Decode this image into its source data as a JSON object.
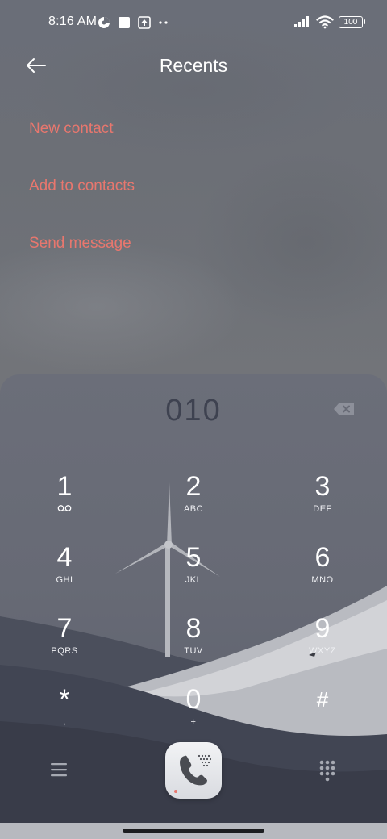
{
  "status_bar": {
    "time": "8:16 AM",
    "battery_label": "100",
    "icons_left": [
      "data-saver-icon",
      "app-square-icon",
      "upload-icon",
      "more-dots-icon"
    ],
    "icons_right": [
      "signal-icon",
      "wifi-icon",
      "battery-icon"
    ]
  },
  "header": {
    "title": "Recents",
    "back_icon": "arrow-left-icon"
  },
  "actions": [
    {
      "label": "New contact"
    },
    {
      "label": "Add to contacts"
    },
    {
      "label": "Send message"
    }
  ],
  "accent_color": "#e8776e",
  "dialpad": {
    "entered_number": "010",
    "keys": [
      {
        "digit": "1",
        "letters": "",
        "sub_icon": "voicemail-icon"
      },
      {
        "digit": "2",
        "letters": "ABC"
      },
      {
        "digit": "3",
        "letters": "DEF"
      },
      {
        "digit": "4",
        "letters": "GHI"
      },
      {
        "digit": "5",
        "letters": "JKL"
      },
      {
        "digit": "6",
        "letters": "MNO"
      },
      {
        "digit": "7",
        "letters": "PQRS"
      },
      {
        "digit": "8",
        "letters": "TUV"
      },
      {
        "digit": "9",
        "letters": "WXYZ"
      },
      {
        "digit": "*",
        "letters": ","
      },
      {
        "digit": "0",
        "letters": "+"
      },
      {
        "digit": "#",
        "letters": ""
      }
    ]
  },
  "bottom_bar": {
    "menu_icon": "menu-icon",
    "call_icon": "phone-icon",
    "dialpad_icon": "dialpad-icon"
  }
}
